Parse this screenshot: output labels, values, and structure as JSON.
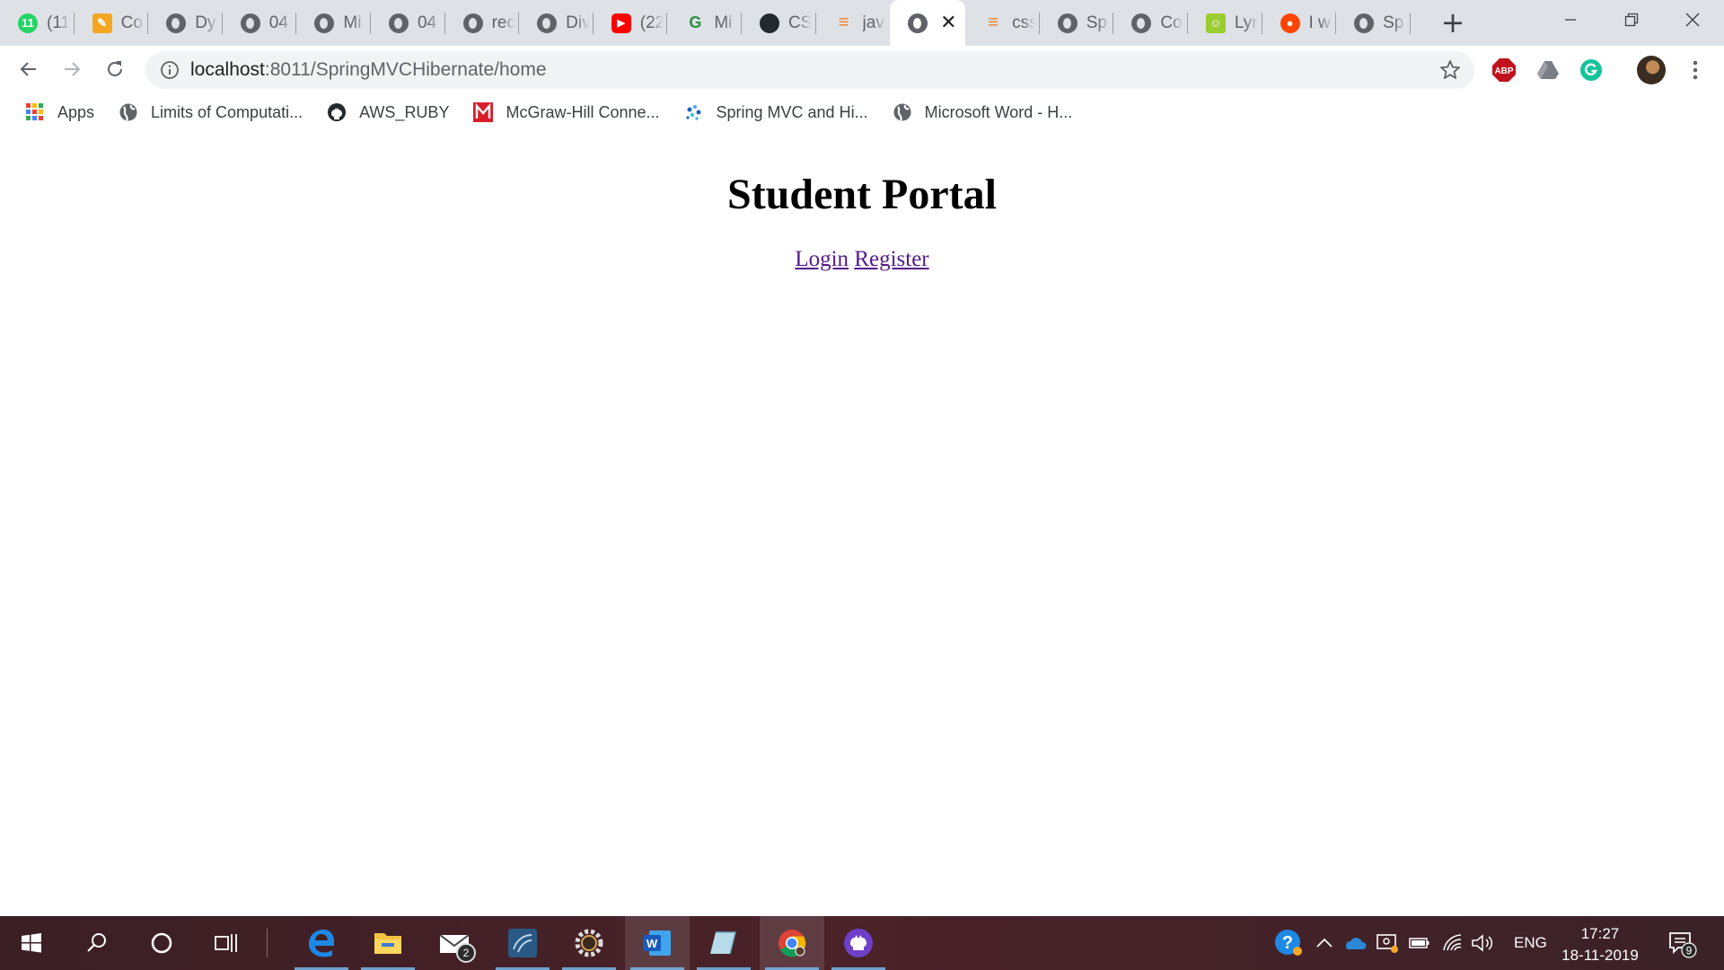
{
  "browser": {
    "tabs": [
      {
        "title": "(11",
        "favicon": "whatsapp-icon",
        "color": "#25d366"
      },
      {
        "title": "Co",
        "favicon": "pencil-icon",
        "color": "#f4a623"
      },
      {
        "title": "Dy",
        "favicon": "globe-icon",
        "color": "#5f6368"
      },
      {
        "title": "04",
        "favicon": "globe-icon",
        "color": "#5f6368"
      },
      {
        "title": "Mi",
        "favicon": "globe-icon",
        "color": "#5f6368"
      },
      {
        "title": "04",
        "favicon": "globe-icon",
        "color": "#5f6368"
      },
      {
        "title": "rec",
        "favicon": "globe-icon",
        "color": "#5f6368"
      },
      {
        "title": "Div",
        "favicon": "globe-icon",
        "color": "#5f6368"
      },
      {
        "title": "(22",
        "favicon": "youtube-icon",
        "color": "#ff0000"
      },
      {
        "title": "Mi",
        "favicon": "geeksforgeeks-icon",
        "color": "#2f8d46"
      },
      {
        "title": "CS",
        "favicon": "github-icon",
        "color": "#24292e"
      },
      {
        "title": "jav",
        "favicon": "stackoverflow-icon",
        "color": "#f48024"
      },
      {
        "title": "",
        "favicon": "globe-icon",
        "color": "#5f6368",
        "active": true
      },
      {
        "title": "css",
        "favicon": "stackoverflow-icon",
        "color": "#f48024"
      },
      {
        "title": "Sp",
        "favicon": "globe-icon",
        "color": "#5f6368"
      },
      {
        "title": "Co",
        "favicon": "globe-icon",
        "color": "#5f6368"
      },
      {
        "title": "Lyr",
        "favicon": "lyrics-icon",
        "color": "#9acd32"
      },
      {
        "title": "I w",
        "favicon": "reddit-icon",
        "color": "#ff4500"
      },
      {
        "title": "Sp",
        "favicon": "globe-icon",
        "color": "#5f6368"
      }
    ],
    "active_tab_close": "✕",
    "new_tab": "+",
    "url_host": "localhost",
    "url_path": ":8011/SpringMVCHibernate/home",
    "extensions": {
      "abp_label": "ABP"
    },
    "bookmarks": [
      {
        "label": "Apps",
        "icon": "apps-grid-icon"
      },
      {
        "label": "Limits of Computati...",
        "icon": "globe-icon"
      },
      {
        "label": "AWS_RUBY",
        "icon": "github-icon"
      },
      {
        "label": "McGraw-Hill Conne...",
        "icon": "mcgraw-hill-icon"
      },
      {
        "label": "Spring MVC and Hi...",
        "icon": "spring-dots-icon"
      },
      {
        "label": "Microsoft Word - H...",
        "icon": "globe-icon"
      }
    ]
  },
  "page": {
    "title": "Student Portal",
    "login_link": "Login",
    "register_link": "Register"
  },
  "taskbar": {
    "mail_badge": "2",
    "lang": "ENG",
    "time": "17:27",
    "date": "18-11-2019",
    "notification_count": "9"
  },
  "colors": {
    "tabstrip_bg": "#dee1e6",
    "link_visited": "#551a8b",
    "taskbar_bg": "#4a2228"
  }
}
